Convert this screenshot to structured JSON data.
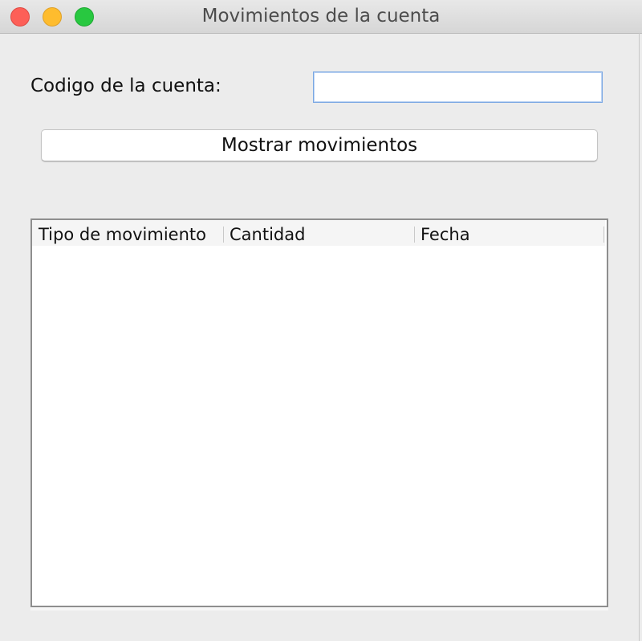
{
  "window": {
    "title": "Movimientos de la cuenta",
    "controls": [
      "close",
      "minimize",
      "maximize"
    ]
  },
  "form": {
    "code_label": "Codigo de la cuenta:",
    "code_value": "",
    "code_placeholder": "",
    "show_button_label": "Mostrar movimientos"
  },
  "table": {
    "columns": [
      "Tipo de movimiento",
      "Cantidad",
      "Fecha"
    ],
    "rows": []
  },
  "colors": {
    "close": "#fd5f57",
    "minimize": "#febc2e",
    "maximize": "#28c840",
    "input_focus_border": "#7aa7e3"
  }
}
